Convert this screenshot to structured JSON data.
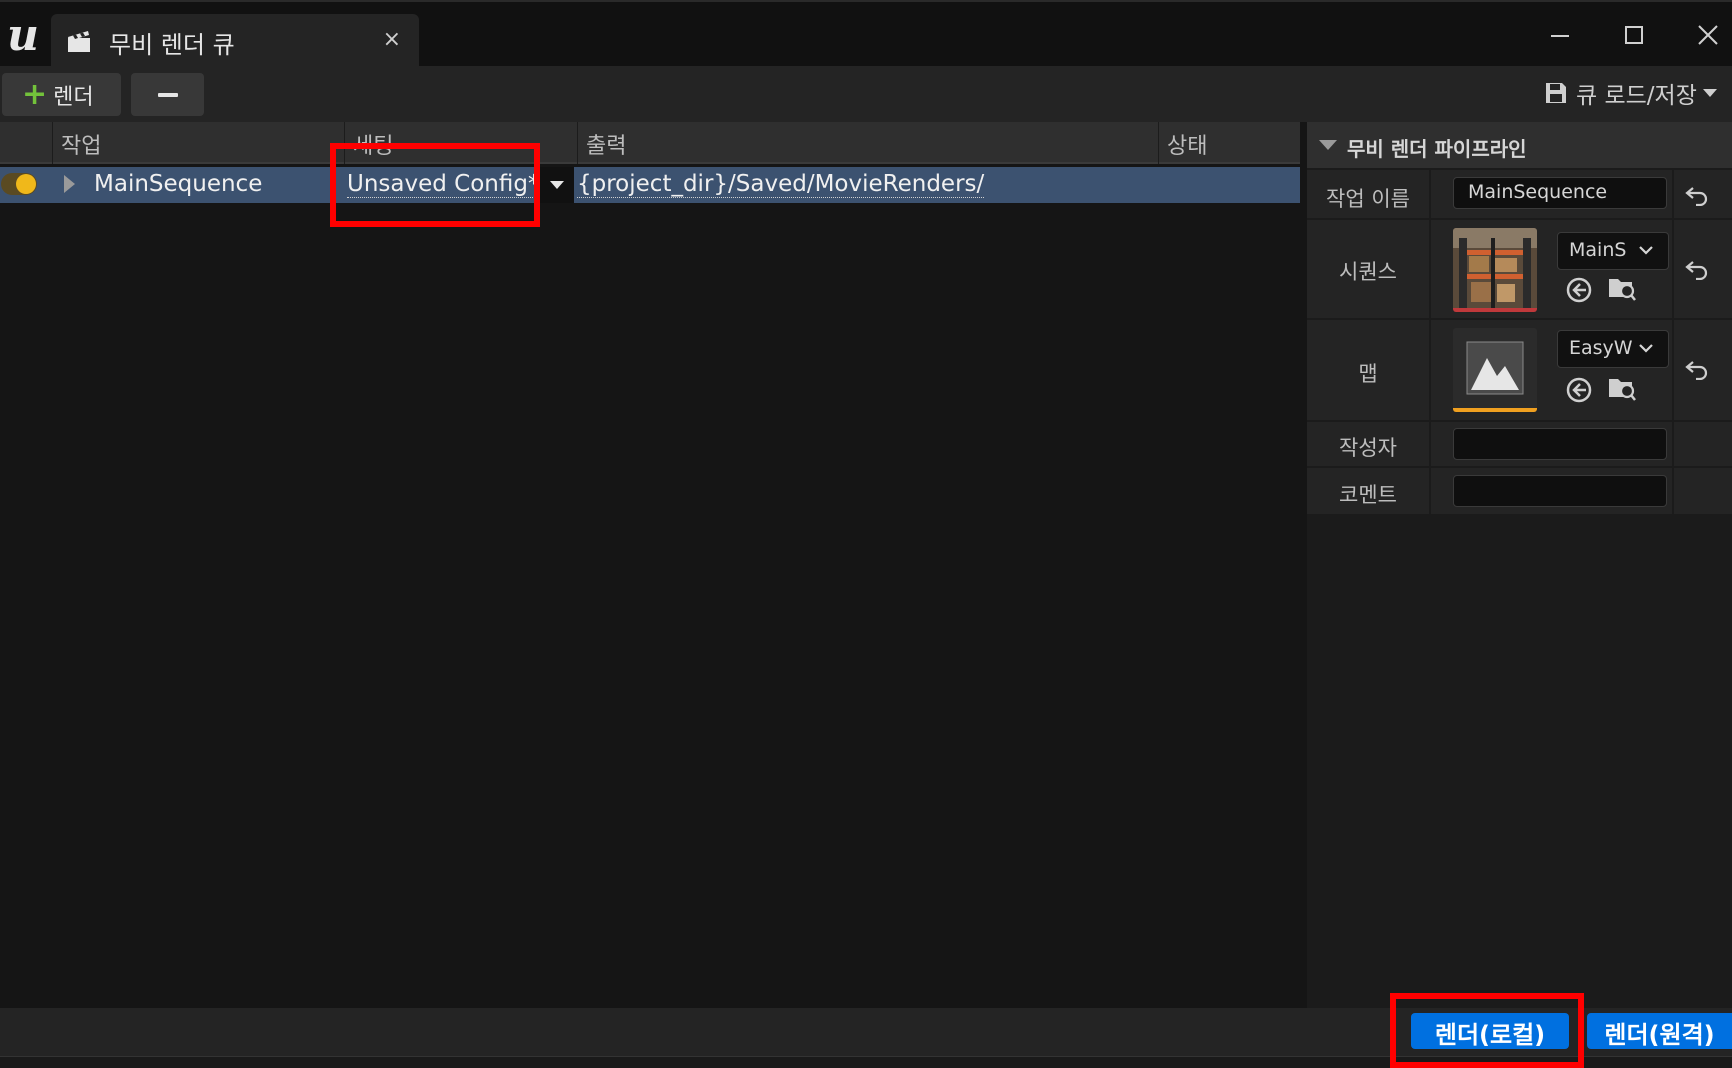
{
  "window": {
    "tab_title": "무비 렌더 큐",
    "tab_close_glyph": "×"
  },
  "toolbar": {
    "render_label": "렌더",
    "queue_load_save_label": "큐 로드/저장"
  },
  "joblist": {
    "columns": [
      "작업",
      "세팅",
      "출력",
      "상태"
    ],
    "rows": [
      {
        "enabled": true,
        "job_name": "MainSequence",
        "settings": "Unsaved Config*",
        "output": "{project_dir}/Saved/MovieRenders/",
        "status": ""
      }
    ]
  },
  "details": {
    "section_title": "무비 렌더 파이프라인",
    "job_name_label": "작업 이름",
    "job_name_value": "MainSequence",
    "sequence_label": "시퀀스",
    "sequence_value": "MainS",
    "map_label": "맵",
    "map_value": "EasyW",
    "author_label": "작성자",
    "author_value": "",
    "comment_label": "코멘트",
    "comment_value": ""
  },
  "bottom": {
    "render_local_label": "렌더(로컬)",
    "render_remote_label": "렌더(원격)"
  },
  "colors": {
    "accent_blue": "#0070e0",
    "selected_row": "#3c5270",
    "toggle_on": "#f0b81a",
    "add_green": "#73c23b",
    "highlight_red": "#ff0000"
  },
  "icons": {
    "app_logo": "unreal-logo-icon",
    "tab": "clapperboard-icon",
    "save": "floppy-disk-icon",
    "reset": "reset-arrow-icon",
    "use_selected": "arrow-left-circle-icon",
    "browse": "folder-search-icon"
  }
}
